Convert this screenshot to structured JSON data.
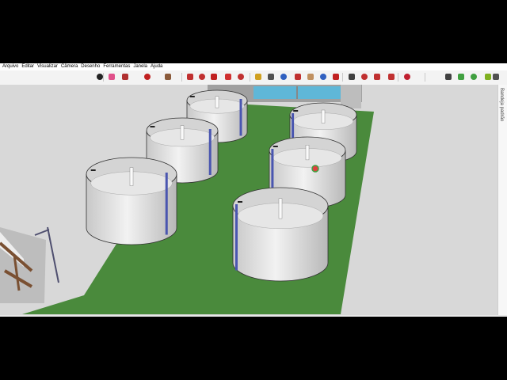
{
  "menu": [
    "Arquivo",
    "Editar",
    "Visualizar",
    "Câmera",
    "Desenho",
    "Ferramentas",
    "Janela",
    "Ajuda"
  ],
  "tray": {
    "label": "Bandeja padrão"
  },
  "toolbar": {
    "tools": [
      {
        "name": "select-tool-button",
        "icon": "arrow-cursor-icon",
        "color": "#222222"
      },
      {
        "name": "eraser-tool-button",
        "icon": "eraser-icon",
        "color": "#e0508a"
      },
      {
        "name": "line-tool-button",
        "icon": "pencil-icon",
        "color": "#b03030"
      },
      {
        "name": "arc-tool-button",
        "icon": "arc-icon",
        "color": "#c02020"
      },
      {
        "name": "rectangle-tool-button",
        "icon": "rectangle-icon",
        "color": "#8a5a3a"
      },
      {
        "name": "push-pull-tool-button",
        "icon": "push-pull-icon",
        "color": "#c03030"
      },
      {
        "name": "follow-me-tool-button",
        "icon": "follow-me-icon",
        "color": "#c03030"
      },
      {
        "name": "move-tool-button",
        "icon": "move-icon",
        "color": "#c02020"
      },
      {
        "name": "rotate-tool-button",
        "icon": "rotate-icon",
        "color": "#d03030"
      },
      {
        "name": "scale-tool-button",
        "icon": "scale-icon",
        "color": "#c03030"
      },
      {
        "name": "tape-measure-tool-button",
        "icon": "tape-measure-icon",
        "color": "#d0a020"
      },
      {
        "name": "text-tool-button",
        "icon": "text-icon",
        "color": "#505050"
      },
      {
        "name": "paint-bucket-tool-button",
        "icon": "paint-bucket-icon",
        "color": "#3060c0"
      },
      {
        "name": "orbit-tool-button",
        "icon": "orbit-icon",
        "color": "#c03030"
      },
      {
        "name": "pan-tool-button",
        "icon": "hand-icon",
        "color": "#c09060"
      },
      {
        "name": "zoom-tool-button",
        "icon": "zoom-icon",
        "color": "#3060c0"
      },
      {
        "name": "zoom-extents-button",
        "icon": "zoom-extents-icon",
        "color": "#c02020"
      },
      {
        "name": "position-camera-button",
        "icon": "camera-icon",
        "color": "#404040"
      },
      {
        "name": "warehouse-button",
        "icon": "warehouse-icon",
        "color": "#c03030"
      },
      {
        "name": "components-button",
        "icon": "components-icon",
        "color": "#c03030"
      },
      {
        "name": "extension-button",
        "icon": "extension-icon",
        "color": "#c03030"
      },
      {
        "name": "ruby-button",
        "icon": "ruby-icon",
        "color": "#c02030"
      },
      {
        "name": "account-button",
        "icon": "user-icon",
        "color": "#404040"
      },
      {
        "name": "geo-location-button",
        "icon": "location-icon",
        "color": "#40a040"
      },
      {
        "name": "layout-button",
        "icon": "layout-icon",
        "color": "#40a040"
      },
      {
        "name": "style-builder-button",
        "icon": "style-icon",
        "color": "#80b020"
      },
      {
        "name": "sandbox-button",
        "icon": "sandbox-icon",
        "color": "#505050"
      },
      {
        "name": "dimension-button",
        "icon": "dimension-icon",
        "color": "#40a040"
      },
      {
        "name": "more-tools-button",
        "icon": "more-icon",
        "color": "#505050"
      }
    ]
  }
}
